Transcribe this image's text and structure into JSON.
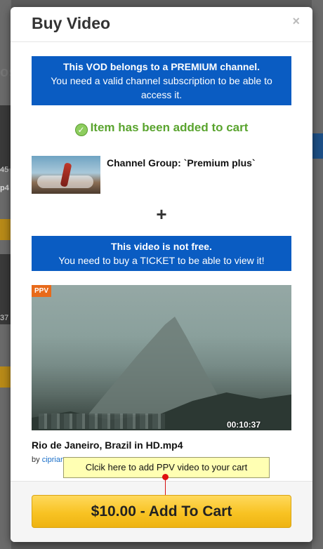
{
  "modal": {
    "title": "Buy Video",
    "close_icon": "×"
  },
  "premium_notice": {
    "line1": "This VOD belongs to a PREMIUM channel.",
    "line2": "You need a valid channel subscription to be able to access it."
  },
  "added_message": "Item has been added to cart",
  "channel_group": {
    "label": "Channel Group: `Premium plus`"
  },
  "plus_symbol": "+",
  "ticket_notice": {
    "line1": "This video is not free.",
    "line2": "You need to buy a TICKET to be able to view it!"
  },
  "video": {
    "badge": "PPV",
    "duration": "00:10:37",
    "title": "Rio de Janeiro, Brazil in HD.mp4",
    "by_label": "by",
    "author": "ciprian"
  },
  "tooltip": "Clcik here to add PPV video to your cart",
  "cart_button": "$10.00 - Add To Cart",
  "background": {
    "fragments": [
      "os",
      "45",
      "p4",
      "37"
    ]
  },
  "colors": {
    "notice_blue": "#0a5cc2",
    "success_green": "#5aa42f",
    "button_yellow": "#f8c323",
    "ppv_orange": "#e86a1a",
    "tooltip_yellow": "#ffffb3",
    "pointer_red": "#e01010"
  },
  "icons": {
    "check": "check-circle-icon",
    "close": "close-icon",
    "pointer": "arrow-down-icon"
  }
}
